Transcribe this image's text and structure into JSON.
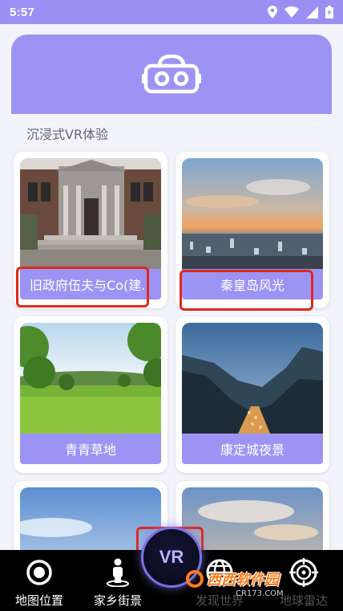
{
  "status_bar": {
    "time": "5:57"
  },
  "banner": {
    "icon": "vr-headset-icon"
  },
  "section_title": "沉浸式VR体验",
  "cards": [
    {
      "label": "旧政府伍夫与Co(建."
    },
    {
      "label": "秦皇岛风光"
    },
    {
      "label": "青青草地"
    },
    {
      "label": "康定城夜景"
    },
    {
      "label": ""
    },
    {
      "label": ""
    }
  ],
  "bottom_nav": {
    "items": [
      {
        "label": "地图位置",
        "icon": "map-location-icon"
      },
      {
        "label": "家乡街景",
        "icon": "street-view-person-icon"
      },
      {
        "label": "发现世界",
        "icon": "globe-icon"
      },
      {
        "label": "地球雷达",
        "icon": "radar-icon"
      }
    ],
    "center": {
      "label": "VR"
    }
  },
  "watermark": {
    "text": "西西软件园",
    "sub": "CR173.COM"
  },
  "colors": {
    "accent": "#9c94f4",
    "highlight": "#e0281e",
    "nav_bg": "#000000"
  }
}
